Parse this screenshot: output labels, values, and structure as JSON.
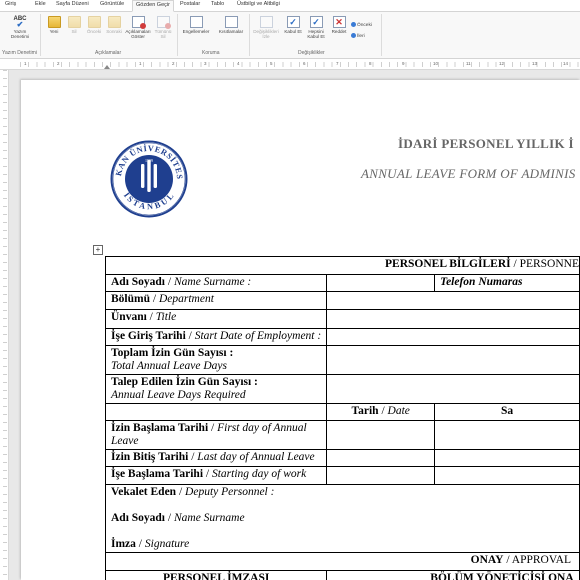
{
  "ribbon": {
    "tabs": [
      "Giriş",
      "Ekle",
      "Sayfa Düzeni",
      "Görüntüle",
      "Gözden Geçir",
      "Postalar",
      "Tablo",
      "Üstbilgi ve Altbilgi"
    ],
    "groups": {
      "proofing": {
        "label": "Yazım Denetimi",
        "spell_button": "Yazım Denetimi",
        "abc": "ABC"
      },
      "comments": {
        "label": "Açıklamalar",
        "buttons": [
          "Yeni",
          "Sil",
          "Önceki",
          "Sonraki",
          "Açıklamaları Göster",
          "Tümünü Sil"
        ]
      },
      "protect": {
        "label": "Koruma",
        "buttons": [
          "Engellemeler",
          "Kısıtlamalar"
        ]
      },
      "changes": {
        "label": "Değişiklikler",
        "buttons": [
          "Değişiklikleri İzle",
          "Kabul Et",
          "Hepsini Kabul Et",
          "Reddet"
        ],
        "nav": [
          "Önceki",
          "İleri"
        ]
      }
    }
  },
  "ruler": {
    "labels": [
      "1",
      "2",
      "1",
      "2",
      "3",
      "4",
      "5",
      "6",
      "7",
      "8",
      "9",
      "10",
      "11",
      "12",
      "13",
      "14"
    ]
  },
  "document": {
    "logo": {
      "text_top": "OKAN ÜNİVERSİTESİ",
      "text_bottom": "İSTANBUL",
      "year": "1999"
    },
    "title_tr": "İDARİ PERSONEL YILLIK İ",
    "title_en": "ANNUAL LEAVE FORM OF ADMINIS",
    "table": {
      "header": {
        "tr": "PERSONEL BİLGİLERİ",
        "sep": " / ",
        "en": "PERSONNE"
      },
      "rows": [
        {
          "tr": "Adı Soyadı",
          "en": "Name Surname :"
        },
        {
          "tr": "Bölümü",
          "en": "Department"
        },
        {
          "tr": "Ünvanı",
          "en": "Title"
        },
        {
          "tr": "İşe Giriş Tarihi",
          "en": "Start Date of Employment :"
        },
        {
          "tr": "Toplam İzin Gün Sayısı :",
          "en": "Total Annual Leave Days"
        },
        {
          "tr": "Talep Edilen İzin Gün Sayısı :",
          "en": "Annual Leave Days Required"
        }
      ],
      "phone": {
        "tr": "Telefon Numaras"
      },
      "date_header": {
        "tr": "Tarih",
        "en": "Date"
      },
      "time_header": {
        "tr": "Sa"
      },
      "date_rows": [
        {
          "tr": "İzin Başlama Tarihi",
          "en": "First day of Annual",
          "en2": "Leave"
        },
        {
          "tr": "İzin Bitiş Tarihi",
          "en": "Last day of Annual Leave"
        },
        {
          "tr": "İşe Başlama Tarihi",
          "en": "Starting day of work"
        }
      ],
      "deputy": {
        "title_tr": "Vekalet Eden",
        "title_en": "Deputy Personnel :",
        "name_tr": "Adı Soyadı",
        "name_en": "Name Surname",
        "sign_tr": "İmza",
        "sign_en": "Signature"
      },
      "approval": {
        "tr": "ONAY",
        "en": "APPROVAL"
      },
      "signatures": {
        "personnel": "PERSONEL İMZASI",
        "manager": "BÖLÜM YÖNETİCİSİ ONA"
      }
    }
  }
}
